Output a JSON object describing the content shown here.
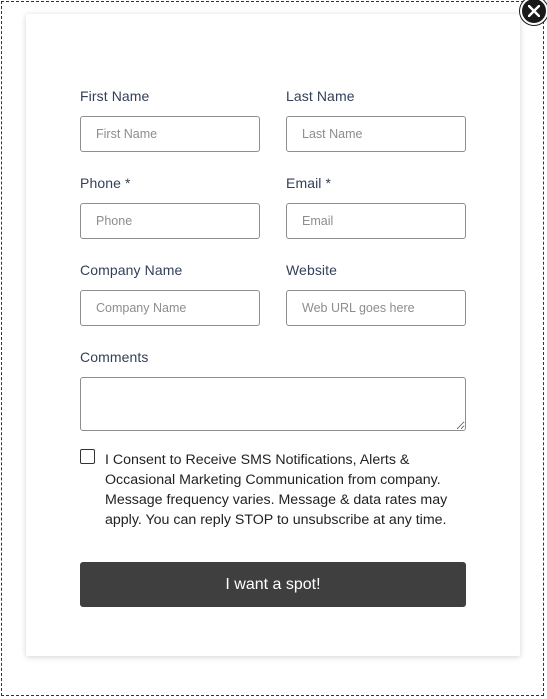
{
  "form": {
    "first_name": {
      "label": "First Name",
      "placeholder": "First Name"
    },
    "last_name": {
      "label": "Last Name",
      "placeholder": "Last Name"
    },
    "phone": {
      "label": "Phone *",
      "placeholder": "Phone"
    },
    "email": {
      "label": "Email *",
      "placeholder": "Email"
    },
    "company": {
      "label": "Company Name",
      "placeholder": "Company Name"
    },
    "website": {
      "label": "Website",
      "placeholder": "Web URL goes here"
    },
    "comments": {
      "label": "Comments",
      "placeholder": ""
    },
    "consent": {
      "checked": false,
      "text": "I Consent to Receive SMS Notifications, Alerts & Occasional Marketing Communication from company. Message frequency varies. Message & data rates may apply. You can reply STOP to unsubscribe at any time."
    },
    "submit_label": "I want a spot!"
  },
  "close_icon": "close-icon",
  "colors": {
    "button_bg": "#3f3f3f",
    "label": "#33405a",
    "frame_border": "#2b3150"
  }
}
